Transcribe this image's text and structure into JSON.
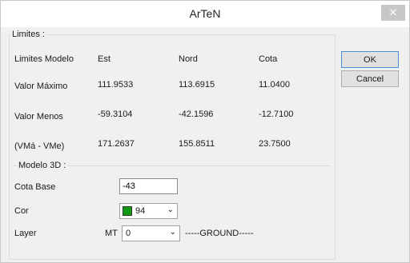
{
  "window": {
    "title": "ArTeN",
    "close_glyph": "✕"
  },
  "limites": {
    "group_label": "Limites :",
    "header": {
      "label": "Limites Modelo",
      "cols": [
        "Est",
        "Nord",
        "Cota"
      ]
    },
    "rows": [
      {
        "label": "Valor Máximo",
        "values": [
          "111.9533",
          "113.6915",
          "11.0400"
        ]
      },
      {
        "label": "Valor Menos",
        "values": [
          "-59.3104",
          "-42.1596",
          "-12.7100"
        ]
      },
      {
        "label": "(VMá - VMe)",
        "values": [
          "171.2637",
          "155.8511",
          "23.7500"
        ]
      }
    ]
  },
  "modelo": {
    "group_label": "Modelo 3D :",
    "cota_base_label": "Cota Base",
    "cota_base_value": "-43",
    "cor_label": "Cor",
    "cor_value": "94",
    "cor_color": "#119911",
    "layer_label": "Layer",
    "layer_prefix": "MT",
    "layer_value": "0",
    "layer_name": "-----GROUND-----"
  },
  "buttons": {
    "ok": "OK",
    "cancel": "Cancel"
  }
}
